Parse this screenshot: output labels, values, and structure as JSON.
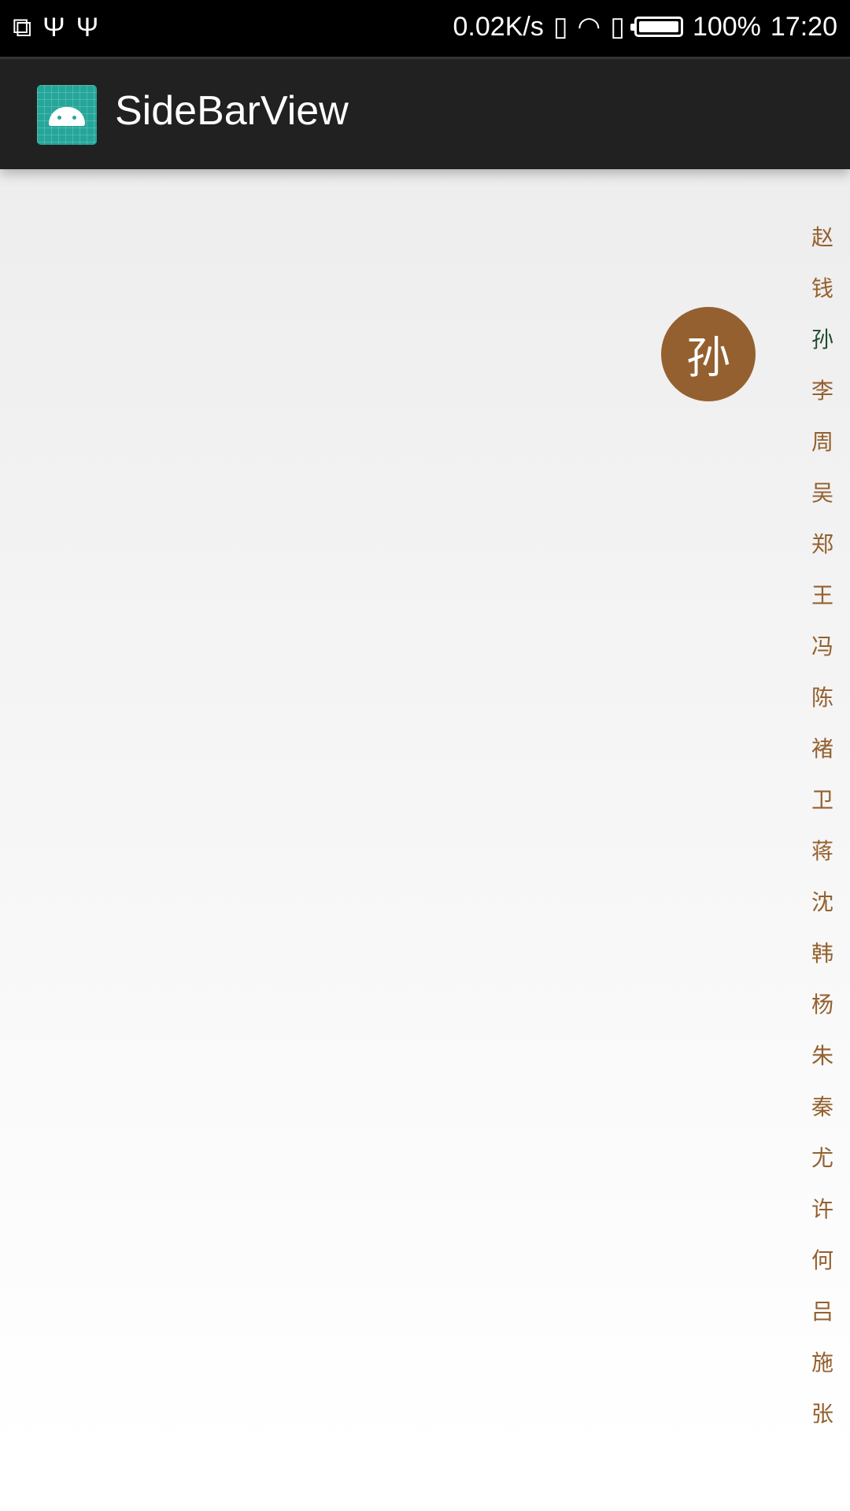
{
  "status_bar": {
    "left_icons": [
      "cast-icon",
      "usb-icon",
      "usb-icon"
    ],
    "net_speed": "0.02K/s",
    "right_icons": [
      "vibrate-icon",
      "wifi-icon",
      "sim-icon",
      "battery-icon"
    ],
    "battery": "100%",
    "time": "17:20"
  },
  "toolbar": {
    "title": "SideBarView",
    "icon": "android-app-icon"
  },
  "selected_letter": "孙",
  "colors": {
    "letter": "#94602f",
    "selected": "#1e4d2b",
    "bubble": "#94602f"
  },
  "sidebar": {
    "letters": [
      "赵",
      "钱",
      "孙",
      "李",
      "周",
      "吴",
      "郑",
      "王",
      "冯",
      "陈",
      "褚",
      "卫",
      "蒋",
      "沈",
      "韩",
      "杨",
      "朱",
      "秦",
      "尤",
      "许",
      "何",
      "吕",
      "施",
      "张"
    ]
  }
}
